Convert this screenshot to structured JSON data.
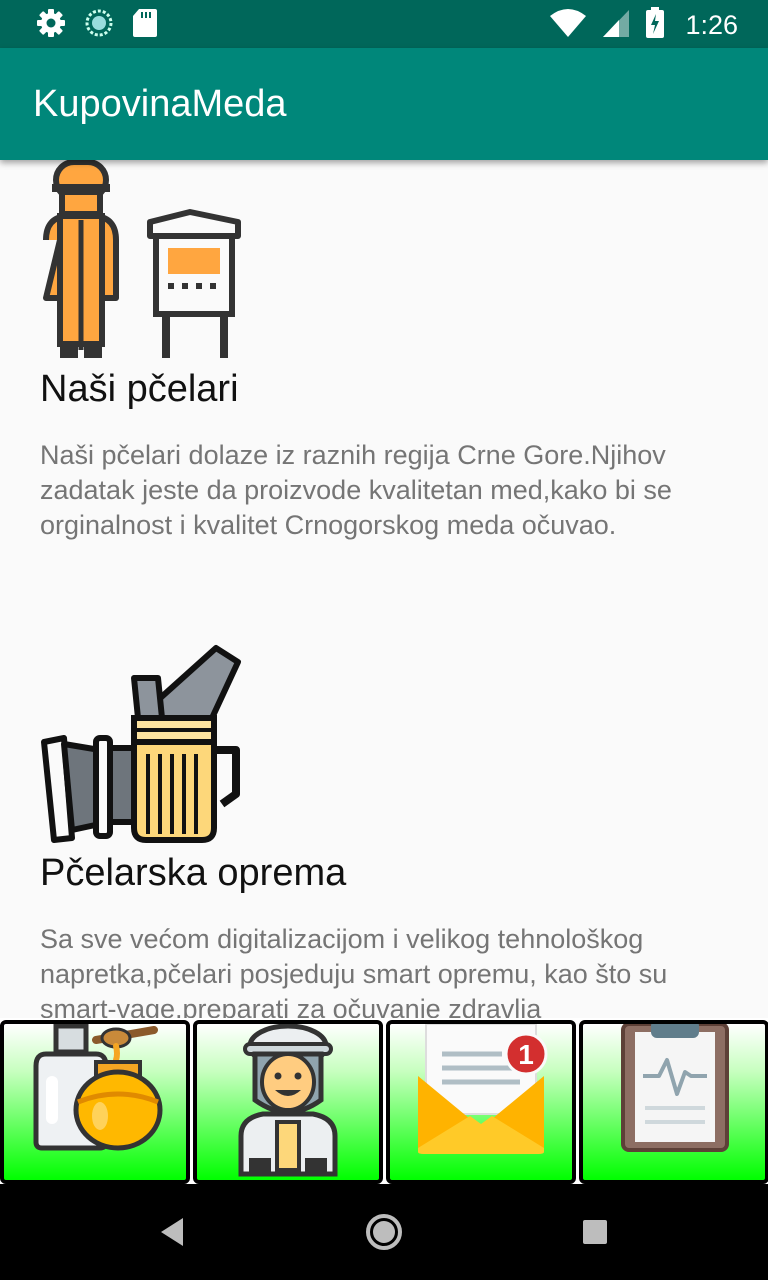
{
  "status_bar": {
    "time": "1:26",
    "left_icons": [
      "gear-icon",
      "sync-icon",
      "sd-card-icon"
    ],
    "right_icons": [
      "wifi-icon",
      "cellular-icon",
      "battery-icon"
    ]
  },
  "app_bar": {
    "title": "KupovinaMeda"
  },
  "sections": [
    {
      "icon": "beekeeper-hive-icon",
      "title": "Naši pčelari",
      "text": "Naši pčelari dolaze iz raznih regija Crne Gore.Njihov zadatak jeste da proizvode kvalitetan med,kako bi se orginalnost i kvalitet Crnogorskog meda očuvao."
    },
    {
      "icon": "bee-smoker-icon",
      "title": "Pčelarska oprema",
      "text": "Sa sve većom digitalizacijom i velikog tehnološkog napretka,pčelari posjeduju smart opremu, kao što su smart-vage,preparati za očuvanje zdravlja"
    }
  ],
  "bottom_nav": [
    {
      "icon": "honey-products-icon"
    },
    {
      "icon": "beekeeper-icon"
    },
    {
      "icon": "mail-notification-icon",
      "badge": "1"
    },
    {
      "icon": "clipboard-icon"
    }
  ],
  "system_nav": [
    "back-icon",
    "home-icon",
    "recents-icon"
  ],
  "colors": {
    "status_bar": "#00675a",
    "app_bar": "#00877a",
    "nav_button_green": "#00ff00",
    "accent_orange": "#ffa640"
  }
}
